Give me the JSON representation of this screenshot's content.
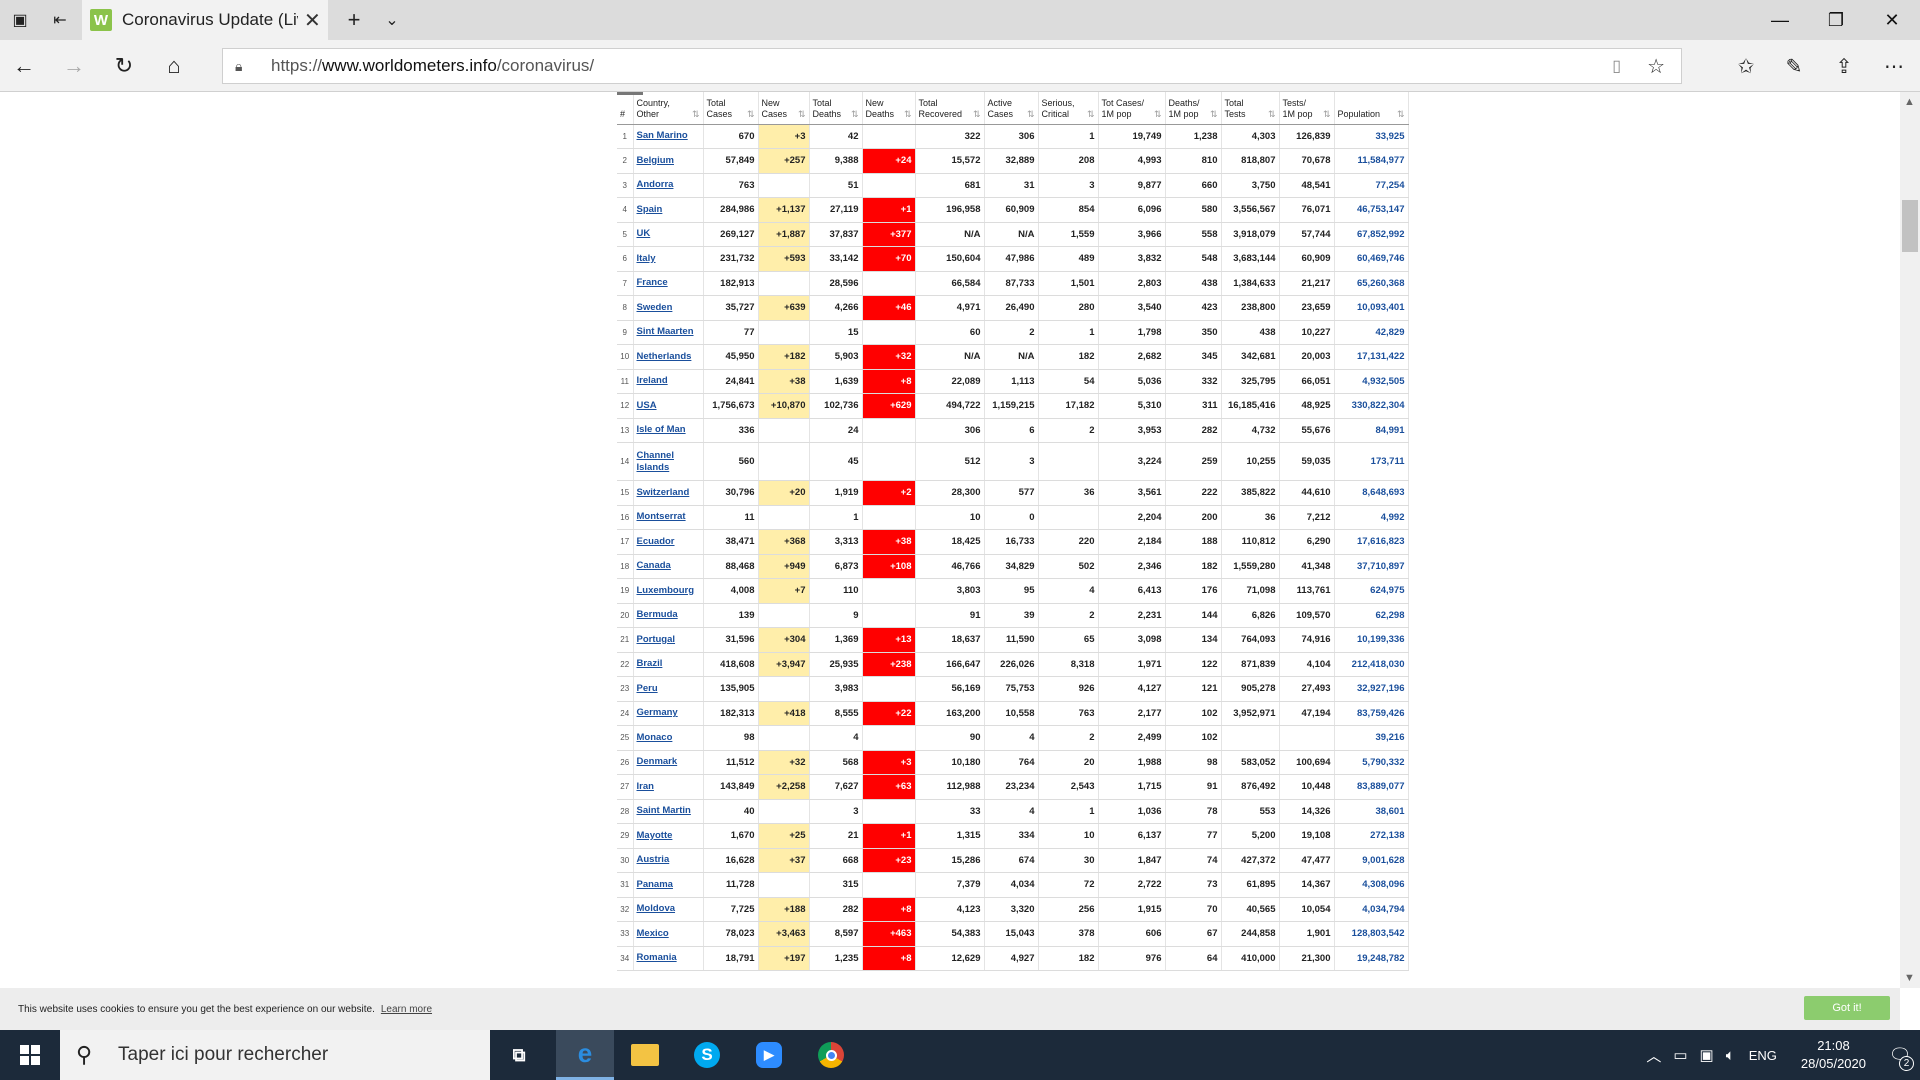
{
  "browser": {
    "tab_title": "Coronavirus Update (Liv",
    "tab_favicon": "W",
    "url_prefix": "https://",
    "url_host": "www.worldometers.info",
    "url_path": "/coronavirus/"
  },
  "table": {
    "headers": [
      "#",
      "Country,\nOther",
      "Total\nCases",
      "New\nCases",
      "Total\nDeaths",
      "New\nDeaths",
      "Total\nRecovered",
      "Active\nCases",
      "Serious,\nCritical",
      "Tot Cases/\n1M pop",
      "Deaths/\n1M pop",
      "Total\nTests",
      "Tests/\n1M pop",
      "Population"
    ],
    "rows": [
      [
        "1",
        "San Marino",
        "670",
        "+3",
        "42",
        "",
        "322",
        "306",
        "1",
        "19,749",
        "1,238",
        "4,303",
        "126,839",
        "33,925"
      ],
      [
        "2",
        "Belgium",
        "57,849",
        "+257",
        "9,388",
        "+24",
        "15,572",
        "32,889",
        "208",
        "4,993",
        "810",
        "818,807",
        "70,678",
        "11,584,977"
      ],
      [
        "3",
        "Andorra",
        "763",
        "",
        "51",
        "",
        "681",
        "31",
        "3",
        "9,877",
        "660",
        "3,750",
        "48,541",
        "77,254"
      ],
      [
        "4",
        "Spain",
        "284,986",
        "+1,137",
        "27,119",
        "+1",
        "196,958",
        "60,909",
        "854",
        "6,096",
        "580",
        "3,556,567",
        "76,071",
        "46,753,147"
      ],
      [
        "5",
        "UK",
        "269,127",
        "+1,887",
        "37,837",
        "+377",
        "N/A",
        "N/A",
        "1,559",
        "3,966",
        "558",
        "3,918,079",
        "57,744",
        "67,852,992"
      ],
      [
        "6",
        "Italy",
        "231,732",
        "+593",
        "33,142",
        "+70",
        "150,604",
        "47,986",
        "489",
        "3,832",
        "548",
        "3,683,144",
        "60,909",
        "60,469,746"
      ],
      [
        "7",
        "France",
        "182,913",
        "",
        "28,596",
        "",
        "66,584",
        "87,733",
        "1,501",
        "2,803",
        "438",
        "1,384,633",
        "21,217",
        "65,260,368"
      ],
      [
        "8",
        "Sweden",
        "35,727",
        "+639",
        "4,266",
        "+46",
        "4,971",
        "26,490",
        "280",
        "3,540",
        "423",
        "238,800",
        "23,659",
        "10,093,401"
      ],
      [
        "9",
        "Sint Maarten",
        "77",
        "",
        "15",
        "",
        "60",
        "2",
        "1",
        "1,798",
        "350",
        "438",
        "10,227",
        "42,829"
      ],
      [
        "10",
        "Netherlands",
        "45,950",
        "+182",
        "5,903",
        "+32",
        "N/A",
        "N/A",
        "182",
        "2,682",
        "345",
        "342,681",
        "20,003",
        "17,131,422"
      ],
      [
        "11",
        "Ireland",
        "24,841",
        "+38",
        "1,639",
        "+8",
        "22,089",
        "1,113",
        "54",
        "5,036",
        "332",
        "325,795",
        "66,051",
        "4,932,505"
      ],
      [
        "12",
        "USA",
        "1,756,673",
        "+10,870",
        "102,736",
        "+629",
        "494,722",
        "1,159,215",
        "17,182",
        "5,310",
        "311",
        "16,185,416",
        "48,925",
        "330,822,304"
      ],
      [
        "13",
        "Isle of Man",
        "336",
        "",
        "24",
        "",
        "306",
        "6",
        "2",
        "3,953",
        "282",
        "4,732",
        "55,676",
        "84,991"
      ],
      [
        "14",
        "Channel Islands",
        "560",
        "",
        "45",
        "",
        "512",
        "3",
        "",
        "3,224",
        "259",
        "10,255",
        "59,035",
        "173,711"
      ],
      [
        "15",
        "Switzerland",
        "30,796",
        "+20",
        "1,919",
        "+2",
        "28,300",
        "577",
        "36",
        "3,561",
        "222",
        "385,822",
        "44,610",
        "8,648,693"
      ],
      [
        "16",
        "Montserrat",
        "11",
        "",
        "1",
        "",
        "10",
        "0",
        "",
        "2,204",
        "200",
        "36",
        "7,212",
        "4,992"
      ],
      [
        "17",
        "Ecuador",
        "38,471",
        "+368",
        "3,313",
        "+38",
        "18,425",
        "16,733",
        "220",
        "2,184",
        "188",
        "110,812",
        "6,290",
        "17,616,823"
      ],
      [
        "18",
        "Canada",
        "88,468",
        "+949",
        "6,873",
        "+108",
        "46,766",
        "34,829",
        "502",
        "2,346",
        "182",
        "1,559,280",
        "41,348",
        "37,710,897"
      ],
      [
        "19",
        "Luxembourg",
        "4,008",
        "+7",
        "110",
        "",
        "3,803",
        "95",
        "4",
        "6,413",
        "176",
        "71,098",
        "113,761",
        "624,975"
      ],
      [
        "20",
        "Bermuda",
        "139",
        "",
        "9",
        "",
        "91",
        "39",
        "2",
        "2,231",
        "144",
        "6,826",
        "109,570",
        "62,298"
      ],
      [
        "21",
        "Portugal",
        "31,596",
        "+304",
        "1,369",
        "+13",
        "18,637",
        "11,590",
        "65",
        "3,098",
        "134",
        "764,093",
        "74,916",
        "10,199,336"
      ],
      [
        "22",
        "Brazil",
        "418,608",
        "+3,947",
        "25,935",
        "+238",
        "166,647",
        "226,026",
        "8,318",
        "1,971",
        "122",
        "871,839",
        "4,104",
        "212,418,030"
      ],
      [
        "23",
        "Peru",
        "135,905",
        "",
        "3,983",
        "",
        "56,169",
        "75,753",
        "926",
        "4,127",
        "121",
        "905,278",
        "27,493",
        "32,927,196"
      ],
      [
        "24",
        "Germany",
        "182,313",
        "+418",
        "8,555",
        "+22",
        "163,200",
        "10,558",
        "763",
        "2,177",
        "102",
        "3,952,971",
        "47,194",
        "83,759,426"
      ],
      [
        "25",
        "Monaco",
        "98",
        "",
        "4",
        "",
        "90",
        "4",
        "2",
        "2,499",
        "102",
        "",
        "",
        "39,216"
      ],
      [
        "26",
        "Denmark",
        "11,512",
        "+32",
        "568",
        "+3",
        "10,180",
        "764",
        "20",
        "1,988",
        "98",
        "583,052",
        "100,694",
        "5,790,332"
      ],
      [
        "27",
        "Iran",
        "143,849",
        "+2,258",
        "7,627",
        "+63",
        "112,988",
        "23,234",
        "2,543",
        "1,715",
        "91",
        "876,492",
        "10,448",
        "83,889,077"
      ],
      [
        "28",
        "Saint Martin",
        "40",
        "",
        "3",
        "",
        "33",
        "4",
        "1",
        "1,036",
        "78",
        "553",
        "14,326",
        "38,601"
      ],
      [
        "29",
        "Mayotte",
        "1,670",
        "+25",
        "21",
        "+1",
        "1,315",
        "334",
        "10",
        "6,137",
        "77",
        "5,200",
        "19,108",
        "272,138"
      ],
      [
        "30",
        "Austria",
        "16,628",
        "+37",
        "668",
        "+23",
        "15,286",
        "674",
        "30",
        "1,847",
        "74",
        "427,372",
        "47,477",
        "9,001,628"
      ],
      [
        "31",
        "Panama",
        "11,728",
        "",
        "315",
        "",
        "7,379",
        "4,034",
        "72",
        "2,722",
        "73",
        "61,895",
        "14,367",
        "4,308,096"
      ],
      [
        "32",
        "Moldova",
        "7,725",
        "+188",
        "282",
        "+8",
        "4,123",
        "3,320",
        "256",
        "1,915",
        "70",
        "40,565",
        "10,054",
        "4,034,794"
      ],
      [
        "33",
        "Mexico",
        "78,023",
        "+3,463",
        "8,597",
        "+463",
        "54,383",
        "15,043",
        "378",
        "606",
        "67",
        "244,858",
        "1,901",
        "128,803,542"
      ],
      [
        "34",
        "Romania",
        "18,791",
        "+197",
        "1,235",
        "+8",
        "12,629",
        "4,927",
        "182",
        "976",
        "64",
        "410,000",
        "21,300",
        "19,248,782"
      ]
    ]
  },
  "cookie": {
    "text": "This website uses cookies to ensure you get the best experience on our website.",
    "link": "Learn more",
    "button": "Got it!"
  },
  "taskbar": {
    "search_placeholder": "Taper ici pour rechercher",
    "lang": "ENG",
    "time": "21:08",
    "date": "28/05/2020",
    "notif_count": "2"
  },
  "colors": {
    "new_cases_bg": "#ffeeaa",
    "new_deaths_bg": "#ff0000",
    "link": "#1a4f9c"
  }
}
